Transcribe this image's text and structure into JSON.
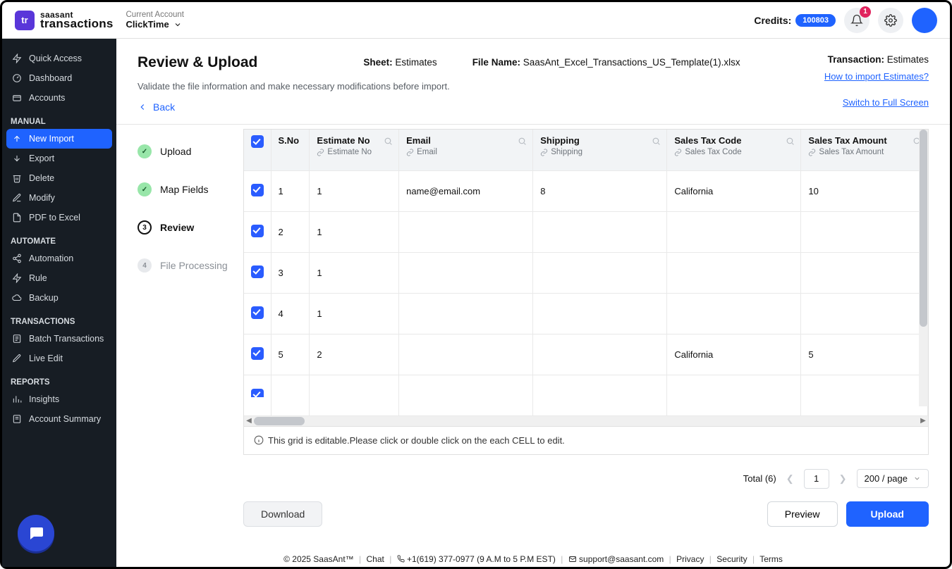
{
  "brand": {
    "line1": "saasant",
    "line2": "transactions",
    "logo": "tr"
  },
  "account": {
    "label": "Current Account",
    "value": "ClickTime"
  },
  "credits": {
    "label": "Credits:",
    "value": "100803"
  },
  "notif_count": "1",
  "sidebar": {
    "top": [
      {
        "label": "Quick Access",
        "icon": "bolt"
      },
      {
        "label": "Dashboard",
        "icon": "gauge"
      },
      {
        "label": "Accounts",
        "icon": "wallet"
      }
    ],
    "sections": [
      {
        "title": "MANUAL",
        "items": [
          {
            "label": "New Import",
            "icon": "upload",
            "active": true
          },
          {
            "label": "Export",
            "icon": "export"
          },
          {
            "label": "Delete",
            "icon": "trash"
          },
          {
            "label": "Modify",
            "icon": "pencil"
          },
          {
            "label": "PDF to Excel",
            "icon": "file"
          }
        ]
      },
      {
        "title": "AUTOMATE",
        "items": [
          {
            "label": "Automation",
            "icon": "share"
          },
          {
            "label": "Rule",
            "icon": "lightning"
          },
          {
            "label": "Backup",
            "icon": "cloud"
          }
        ]
      },
      {
        "title": "TRANSACTIONS",
        "items": [
          {
            "label": "Batch Transactions",
            "icon": "doc"
          },
          {
            "label": "Live Edit",
            "icon": "pencil"
          }
        ]
      },
      {
        "title": "REPORTS",
        "items": [
          {
            "label": "Insights",
            "icon": "bars"
          },
          {
            "label": "Account Summary",
            "icon": "doc"
          }
        ]
      }
    ]
  },
  "page": {
    "title": "Review & Upload",
    "sheet_key": "Sheet:",
    "sheet_val": "Estimates",
    "file_key": "File Name:",
    "file_val": "SaasAnt_Excel_Transactions_US_Template(1).xlsx",
    "trans_key": "Transaction:",
    "trans_val": "Estimates",
    "subtitle": "Validate the file information and make necessary modifications before import.",
    "help_link": "How to import Estimates?",
    "fullscreen_link": "Switch to Full Screen",
    "back": "Back"
  },
  "steps": [
    {
      "label": "Upload",
      "state": "done"
    },
    {
      "label": "Map Fields",
      "state": "done"
    },
    {
      "label": "Review",
      "state": "active",
      "num": "3"
    },
    {
      "label": "File Processing",
      "state": "future",
      "num": "4"
    }
  ],
  "grid": {
    "columns": [
      {
        "name": "S.No"
      },
      {
        "name": "Estimate No",
        "map": "Estimate No"
      },
      {
        "name": "Email",
        "map": "Email"
      },
      {
        "name": "Shipping",
        "map": "Shipping"
      },
      {
        "name": "Sales Tax Code",
        "map": "Sales Tax Code"
      },
      {
        "name": "Sales Tax Amount",
        "map": "Sales Tax Amount"
      }
    ],
    "rows": [
      {
        "sno": "1",
        "est": "1",
        "email": "name@email.com",
        "ship": "8",
        "taxcode": "California",
        "taxamt": "10"
      },
      {
        "sno": "2",
        "est": "1",
        "email": "",
        "ship": "",
        "taxcode": "",
        "taxamt": ""
      },
      {
        "sno": "3",
        "est": "1",
        "email": "",
        "ship": "",
        "taxcode": "",
        "taxamt": ""
      },
      {
        "sno": "4",
        "est": "1",
        "email": "",
        "ship": "",
        "taxcode": "",
        "taxamt": ""
      },
      {
        "sno": "5",
        "est": "2",
        "email": "",
        "ship": "",
        "taxcode": "California",
        "taxamt": "5"
      }
    ],
    "note": "This grid is editable.Please click or double click on the each CELL to edit."
  },
  "pager": {
    "total_label": "Total (6)",
    "page": "1",
    "per_page": "200 / page"
  },
  "buttons": {
    "download": "Download",
    "preview": "Preview",
    "upload": "Upload"
  },
  "footer": {
    "copy": "© 2025 SaasAnt™",
    "chat": "Chat",
    "phone": "+1(619) 377-0977 (9 A.M to 5 P.M EST)",
    "email": "support@saasant.com",
    "links": [
      "Privacy",
      "Security",
      "Terms"
    ]
  }
}
